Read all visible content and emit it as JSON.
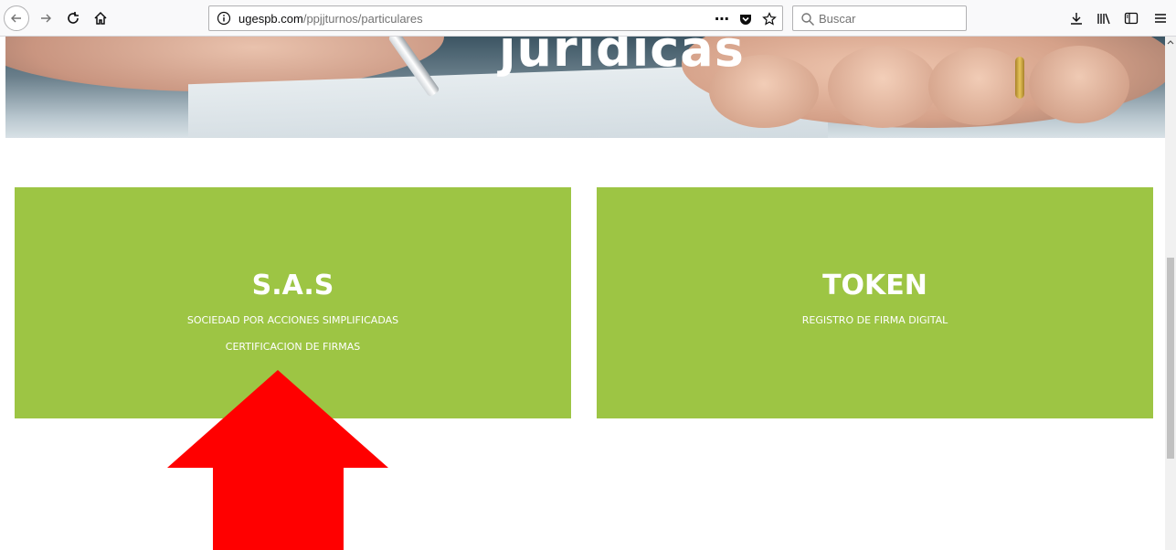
{
  "browser": {
    "url_domain": "ugespb.com",
    "url_path": "/ppjjturnos/particulares",
    "search_placeholder": "Buscar",
    "page_actions_label": "⋯"
  },
  "hero": {
    "title": "jurídicas"
  },
  "cards": [
    {
      "title": "S.A.S",
      "lines": [
        "SOCIEDAD POR ACCIONES SIMPLIFICADAS",
        "CERTIFICACION DE FIRMAS"
      ]
    },
    {
      "title": "TOKEN",
      "lines": [
        "REGISTRO DE FIRMA DIGITAL"
      ]
    }
  ],
  "colors": {
    "card_green": "#9dc544",
    "annotation_arrow": "#ff0000"
  },
  "annotation": {
    "icon": "red-arrow-up-icon"
  }
}
